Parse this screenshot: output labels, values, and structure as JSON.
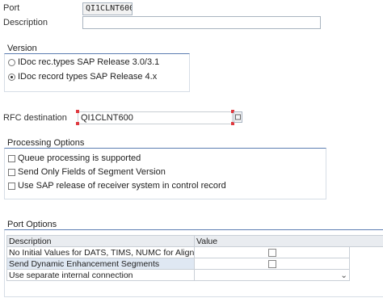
{
  "header": {
    "port_label": "Port",
    "port_value": "QI1CLNT600",
    "description_label": "Description",
    "description_value": ""
  },
  "version": {
    "title": "Version",
    "options": [
      {
        "label": "IDoc rec.types SAP Release 3.0/3.1",
        "selected": false
      },
      {
        "label": "IDoc record types SAP Release 4.x",
        "selected": true
      }
    ]
  },
  "rfc": {
    "label": "RFC destination",
    "value": "QI1CLNT600"
  },
  "processing": {
    "title": "Processing Options",
    "options": [
      {
        "label": "Queue processing is supported",
        "checked": false
      },
      {
        "label": "Send Only Fields of Segment Version",
        "checked": false
      },
      {
        "label": "Use SAP release of receiver system in control record",
        "checked": false
      }
    ]
  },
  "port_options": {
    "title": "Port Options",
    "columns": [
      "Description",
      "Value"
    ],
    "rows": [
      {
        "description": "No Initial Values for DATS, TIMS, NUMC for Alignment",
        "value_type": "checkbox"
      },
      {
        "description": "Send Dynamic Enhancement Segments",
        "value_type": "checkbox"
      },
      {
        "description": "Use separate internal connection",
        "value_type": "dropdown"
      }
    ]
  }
}
